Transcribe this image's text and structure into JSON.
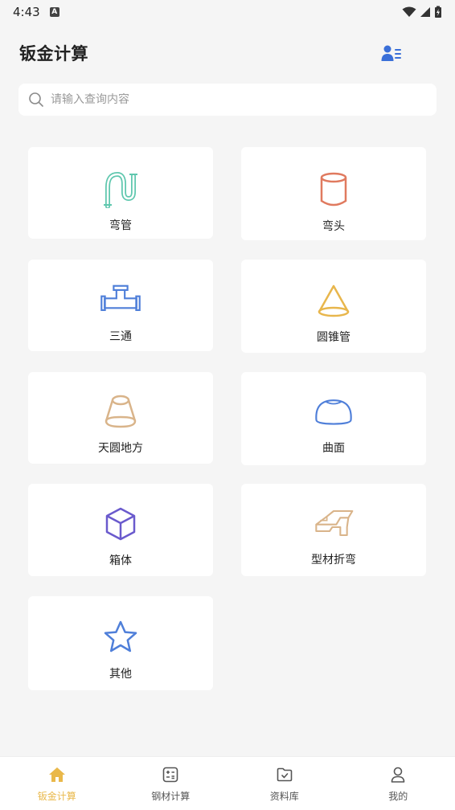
{
  "status_bar": {
    "time": "4:43",
    "badge": "A"
  },
  "header": {
    "title": "钣金计算"
  },
  "search": {
    "placeholder": "请输入查询内容",
    "value": ""
  },
  "colors": {
    "accent": "#e9b84a",
    "blue": "#3a6fd8",
    "teal": "#5fc7ae",
    "orange": "#e07a5f",
    "gold": "#e8b64c",
    "tan": "#d9b48a",
    "purple": "#6a5acd"
  },
  "grid": [
    {
      "label": "弯管",
      "icon": "pipe-bend-icon"
    },
    {
      "label": "弯头",
      "icon": "cylinder-icon"
    },
    {
      "label": "三通",
      "icon": "tee-pipe-icon"
    },
    {
      "label": "圆锥管",
      "icon": "cone-icon"
    },
    {
      "label": "天圆地方",
      "icon": "frustum-icon"
    },
    {
      "label": "曲面",
      "icon": "dome-icon"
    },
    {
      "label": "箱体",
      "icon": "box-icon"
    },
    {
      "label": "型材折弯",
      "icon": "profile-bend-icon"
    },
    {
      "label": "其他",
      "icon": "star-icon"
    }
  ],
  "tabs": [
    {
      "label": "钣金计算",
      "icon": "home-icon",
      "active": true
    },
    {
      "label": "钢材计算",
      "icon": "calculator-icon",
      "active": false
    },
    {
      "label": "资料库",
      "icon": "folder-check-icon",
      "active": false
    },
    {
      "label": "我的",
      "icon": "user-icon",
      "active": false
    }
  ]
}
